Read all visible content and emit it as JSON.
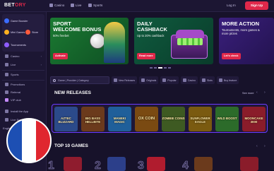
{
  "brand": {
    "name_part1": "BET",
    "name_part2": "ORY"
  },
  "topnav": [
    {
      "label": "Casino",
      "icon": "casino-icon"
    },
    {
      "label": "Live",
      "icon": "live-icon"
    },
    {
      "label": "Sports",
      "icon": "sports-icon"
    }
  ],
  "auth": {
    "login": "Log In",
    "signup": "Sign Up"
  },
  "sidebar": {
    "chips": [
      {
        "label": "Game Booster",
        "color": "#3b6cff"
      },
      {
        "label": "Mini Games",
        "color": "#ffb020"
      },
      {
        "label": "Store",
        "color": "#ff5a3c"
      },
      {
        "label": "Tournaments",
        "color": "#8f5cff"
      }
    ],
    "items": [
      {
        "label": "Casino",
        "icon": "casino-icon",
        "chevron": "›"
      },
      {
        "label": "Live",
        "icon": "live-icon",
        "chevron": "›"
      },
      {
        "label": "Sports",
        "icon": "sports-icon",
        "chevron": ""
      },
      {
        "label": "Promotions",
        "icon": "gift-icon",
        "chevron": ""
      },
      {
        "label": "Referral",
        "icon": "referral-icon",
        "chevron": ""
      },
      {
        "label": "VIP club",
        "icon": "vip-icon",
        "chevron": ""
      },
      {
        "label": "Install the App",
        "icon": "download-icon",
        "chevron": ""
      },
      {
        "label": "Live Support",
        "icon": "support-icon",
        "chevron": ""
      }
    ],
    "language_label": "English"
  },
  "banners": [
    {
      "title_line1": "SPORT",
      "title_line2": "WELCOME BONUS",
      "subtitle": "50% freebet",
      "button": "Activate"
    },
    {
      "title_line1": "DAILY",
      "title_line2": "CASHBACK",
      "subtitle": "Up to 20% cashback",
      "button": "Read more"
    },
    {
      "title_line1": "MORE ACTION",
      "title_line2": "",
      "subtitle": "Tournaments, more games & more prizes",
      "button": "Let's check"
    }
  ],
  "filters": {
    "search_placeholder": "Game | Provider | Category",
    "categories": [
      "New Releases",
      "Originals",
      "Popular",
      "Casino",
      "Slots",
      "Buy feature"
    ]
  },
  "sections": {
    "new_releases": {
      "title": "NEW RELEASES",
      "see_more": "See more",
      "arrows": "‹ ›"
    },
    "top10": {
      "title": "TOP 10 GAMES",
      "arrows": "‹ ›",
      "numbers": [
        "1",
        "2",
        "3",
        "4"
      ]
    }
  },
  "games": [
    {
      "title": "Aztec Blizzard",
      "color": "#2b4a8a"
    },
    {
      "title": "Big Bass Hellbite",
      "color": "#6b3a1c"
    },
    {
      "title": "Maneki Magic",
      "color": "#1f5f9a"
    },
    {
      "title": "Ox Coin",
      "color": "#7a4a12"
    },
    {
      "title": "Zombie Coins",
      "color": "#3e5a22"
    },
    {
      "title": "Sunflower Eagle",
      "color": "#7a5a10"
    },
    {
      "title": "Wild Boost",
      "color": "#2c6b2a"
    },
    {
      "title": "Mooncake 3000",
      "color": "#8a1c2a"
    }
  ],
  "top10_colors": [
    "#8f1c2e",
    "#2c3f8a",
    "#b01c2e",
    "#6b3a1c"
  ]
}
